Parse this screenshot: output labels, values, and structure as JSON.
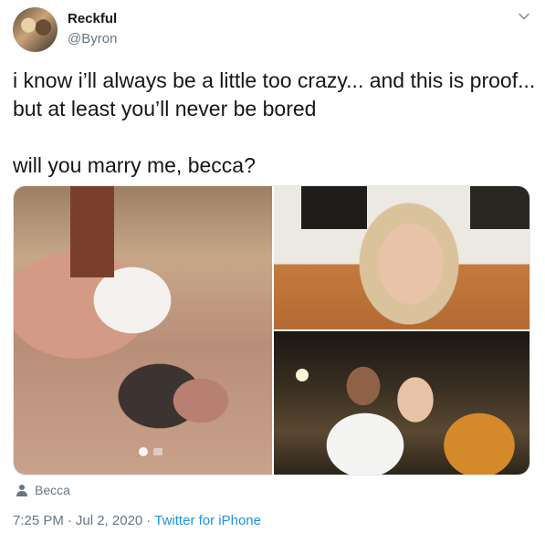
{
  "tweet": {
    "author_name": "Reckful",
    "author_handle": "@Byron",
    "text": "i know i’ll always be a little too crazy... and this is proof...\nbut at least you’ll never be bored\n\nwill you marry me, becca?",
    "tagged_person": "Becca",
    "time": "7:25 PM",
    "date": "Jul 2, 2020",
    "separator": "·",
    "source": "Twitter for iPhone"
  },
  "icons": {
    "menu_caret": "chevron-down-icon",
    "tag": "person-icon"
  },
  "colors": {
    "text_primary": "#14171a",
    "text_secondary": "#657786",
    "link": "#1b95e0",
    "border": "#e1e8ed"
  }
}
